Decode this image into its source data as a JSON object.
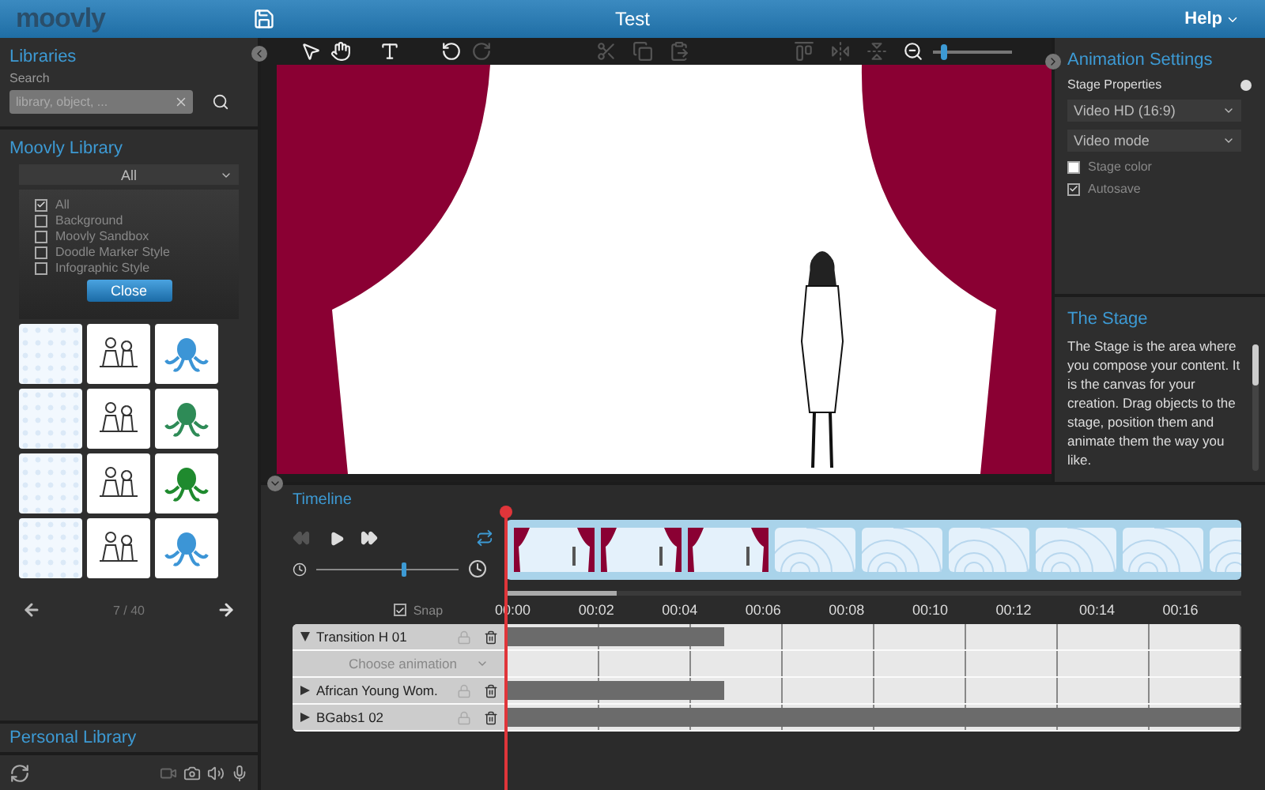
{
  "app": {
    "logo": "moovly",
    "title": "Test",
    "help": "Help"
  },
  "libraries": {
    "title": "Libraries",
    "search_label": "Search",
    "placeholder": "library, object, ..."
  },
  "moovly_library": {
    "title": "Moovly Library",
    "filter": "All",
    "categories": [
      {
        "label": "All",
        "checked": true
      },
      {
        "label": "Background",
        "checked": false
      },
      {
        "label": "Moovly Sandbox",
        "checked": false
      },
      {
        "label": "Doodle Marker Style",
        "checked": false
      },
      {
        "label": "Infographic Style",
        "checked": false
      }
    ],
    "close": "Close",
    "thumbnails": [
      {
        "kind": "pattern"
      },
      {
        "kind": "sketch"
      },
      {
        "kind": "creature",
        "color": "#3c95d6"
      },
      {
        "kind": "pattern"
      },
      {
        "kind": "sketch"
      },
      {
        "kind": "creature",
        "color": "#2e8b57"
      },
      {
        "kind": "pattern"
      },
      {
        "kind": "sketch"
      },
      {
        "kind": "creature",
        "color": "#1f8a2e"
      },
      {
        "kind": "pattern"
      },
      {
        "kind": "sketch"
      },
      {
        "kind": "creature",
        "color": "#3c95d6"
      }
    ],
    "pager": "7 / 40"
  },
  "personal_library": {
    "title": "Personal Library"
  },
  "toolbar": [
    {
      "kind": "pointer",
      "disabled": false
    },
    {
      "kind": "hand",
      "disabled": false
    },
    {
      "kind": "text",
      "disabled": false
    },
    {
      "kind": "undo",
      "disabled": false
    },
    {
      "kind": "redo",
      "disabled": true
    },
    {
      "kind": "cut",
      "disabled": true
    },
    {
      "kind": "copy",
      "disabled": true
    },
    {
      "kind": "paste",
      "disabled": true
    },
    {
      "kind": "align",
      "disabled": true
    },
    {
      "kind": "flip-h",
      "disabled": true
    },
    {
      "kind": "flip-v",
      "disabled": true
    },
    {
      "kind": "zoom",
      "disabled": false
    }
  ],
  "zoom": {
    "level": 0.1
  },
  "animation_settings": {
    "title": "Animation Settings",
    "section": "Stage Properties",
    "selects": [
      "Video HD (16:9)",
      "Video mode"
    ],
    "options": [
      {
        "label": "Stage color",
        "checked": false
      },
      {
        "label": "Autosave",
        "checked": true
      }
    ]
  },
  "the_stage": {
    "title": "The Stage",
    "text": "The Stage is the area where you compose your content. It is the canvas for your creation. Drag objects to the stage, position them and animate them the way you like."
  },
  "timeline": {
    "title": "Timeline",
    "speed": {
      "level": 0.6
    },
    "snap": {
      "label": "Snap",
      "checked": true
    },
    "frames": [
      {
        "kind": "curtain"
      },
      {
        "kind": "curtain"
      },
      {
        "kind": "curtain"
      },
      {
        "kind": "empty"
      },
      {
        "kind": "empty"
      },
      {
        "kind": "empty"
      },
      {
        "kind": "empty"
      },
      {
        "kind": "empty"
      },
      {
        "kind": "empty"
      }
    ],
    "ticks": [
      "00:00",
      "00:02",
      "00:04",
      "00:06",
      "00:08",
      "00:10",
      "00:12",
      "00:14",
      "00:16"
    ],
    "tracks": [
      {
        "name": "Transition H 01",
        "expanded": true,
        "level": 0.295,
        "animation": "Choose animation"
      },
      {
        "name": "African Young Wom.",
        "expanded": false,
        "level": 0.295
      },
      {
        "name": "BGabs1 02",
        "expanded": false,
        "level": 1
      }
    ]
  }
}
